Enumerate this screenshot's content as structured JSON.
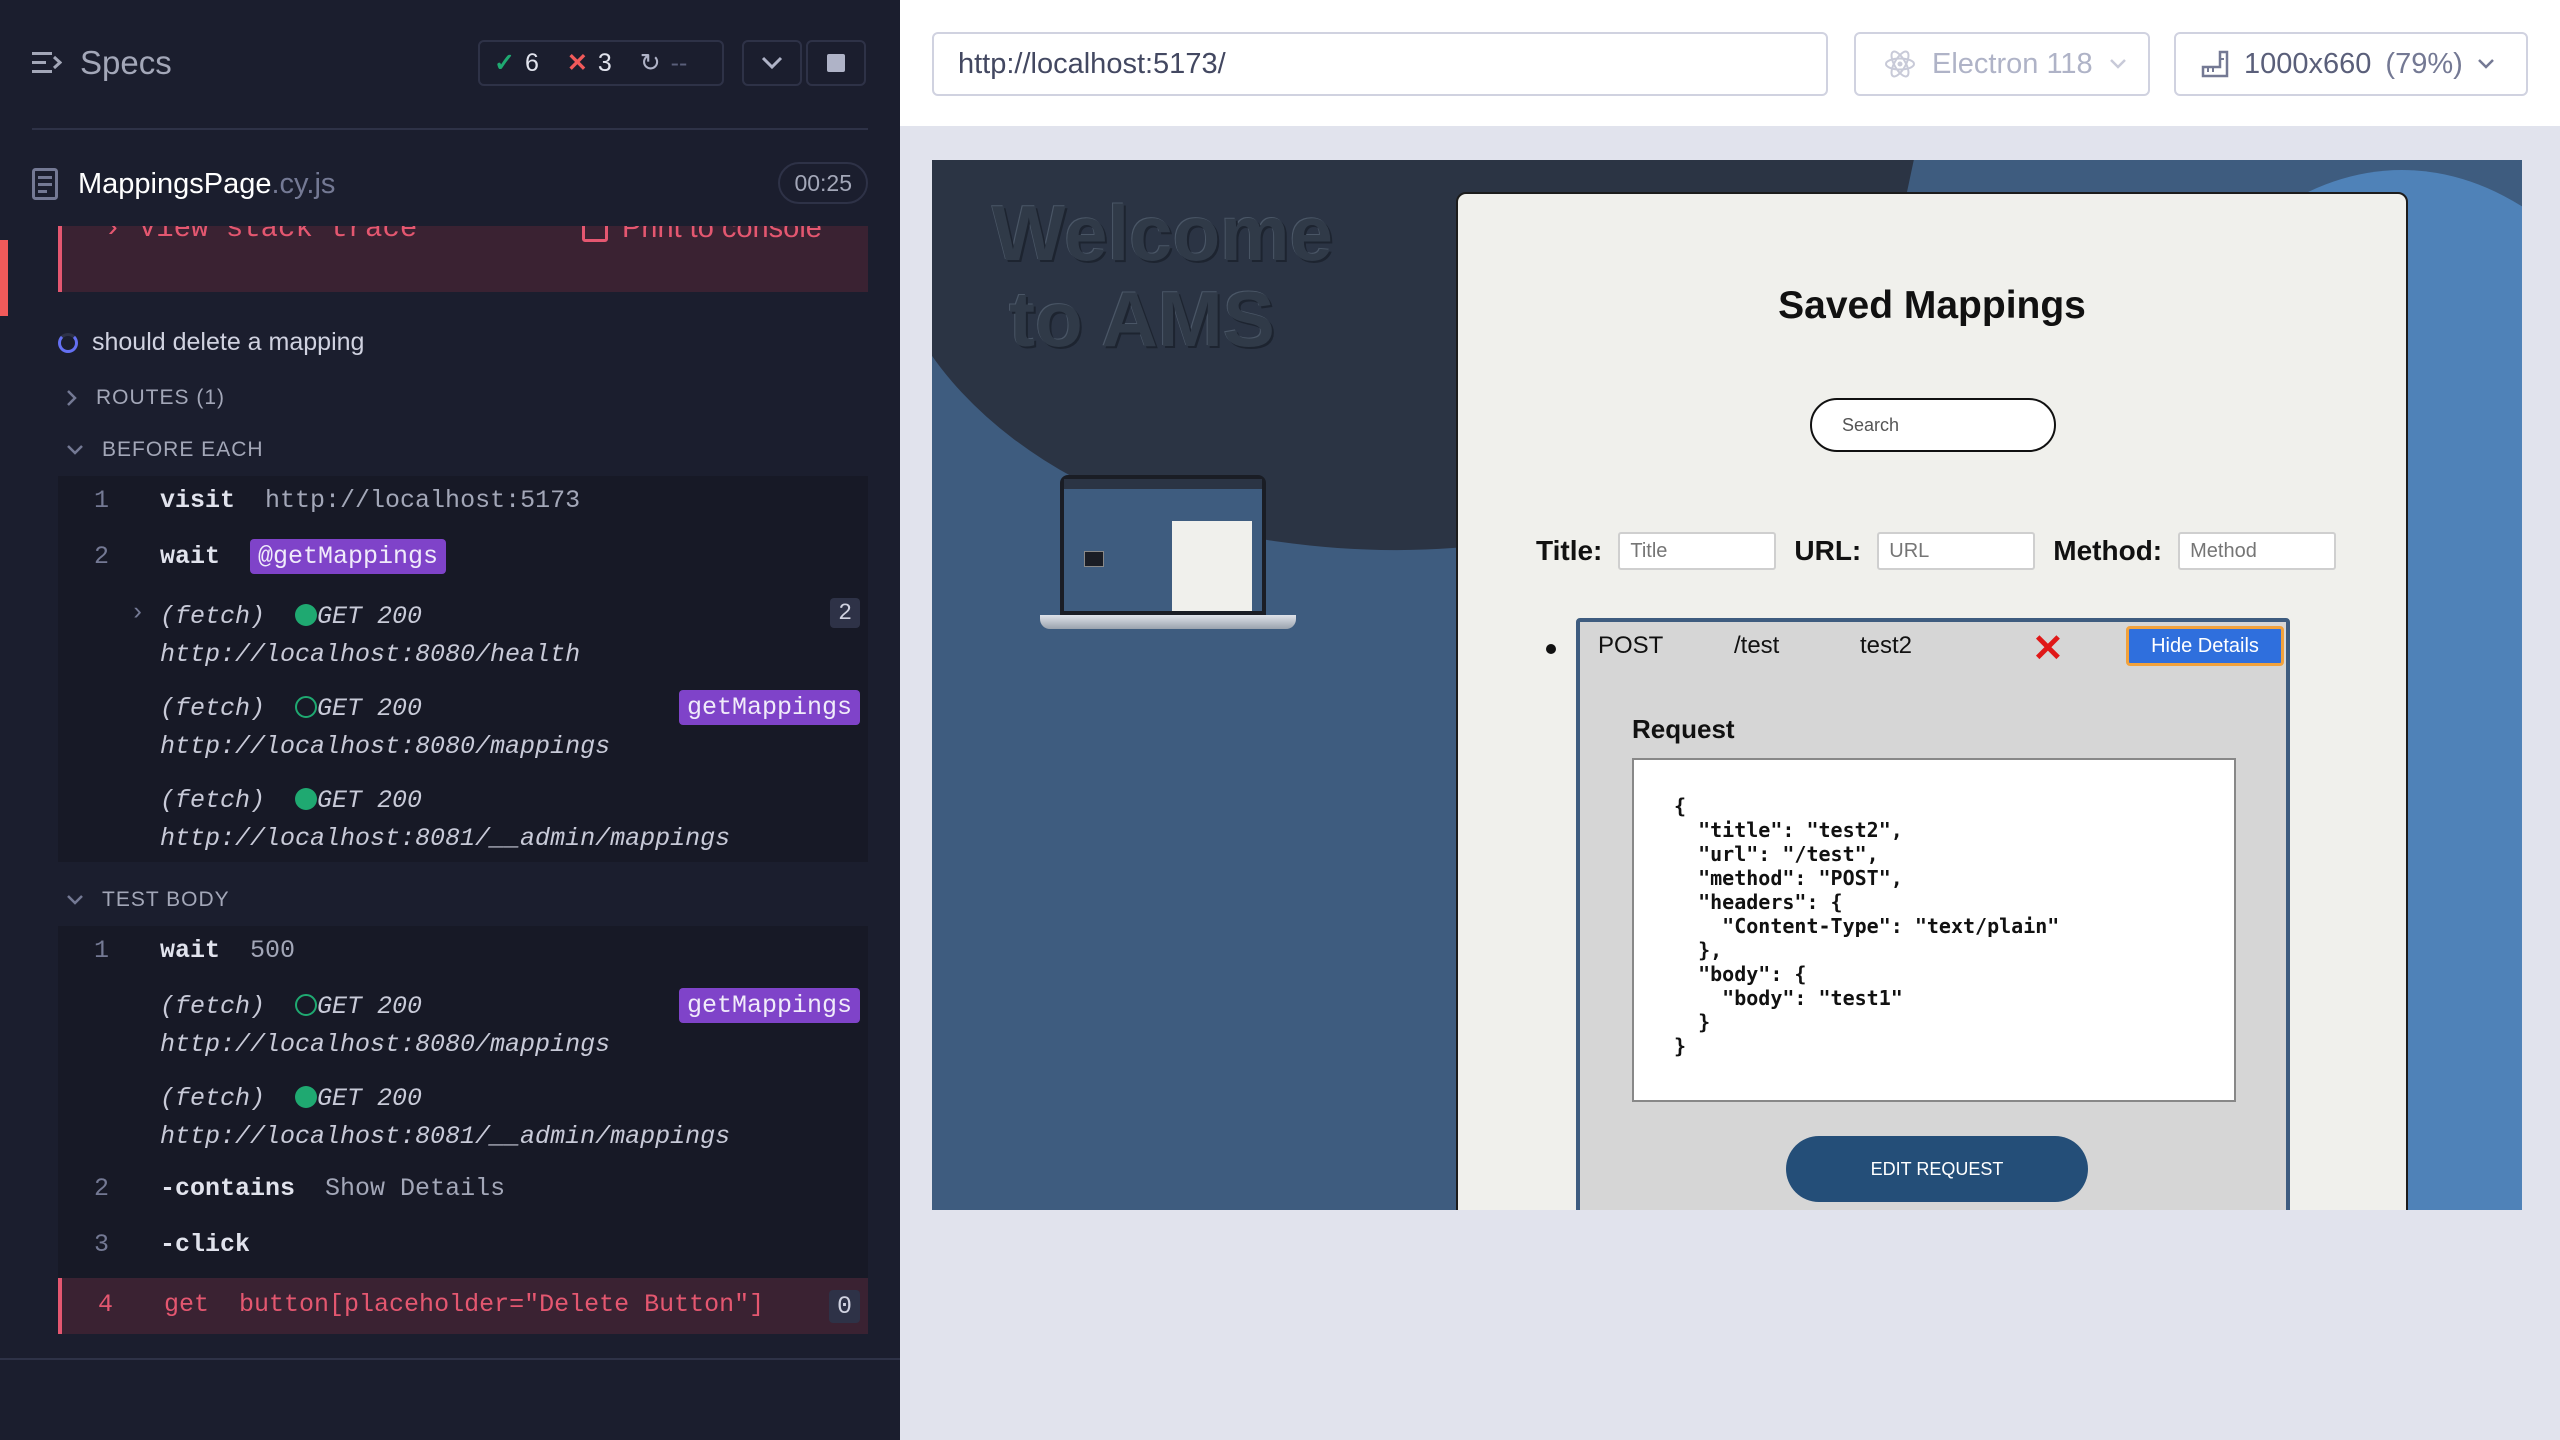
{
  "reporter": {
    "specs_label": "Specs",
    "stats": {
      "passed": "6",
      "failed": "3",
      "pending": "--"
    },
    "spec_file": {
      "name": "MappingsPage",
      "ext": ".cy.js",
      "duration": "00:25"
    },
    "error": {
      "stack_trace_label": "View stack trace",
      "print_label": "Print to console"
    },
    "test_title": "should delete a mapping",
    "routes_label": "ROUTES (1)",
    "before_each_label": "BEFORE EACH",
    "test_body_label": "TEST BODY",
    "before_each": [
      {
        "num": "1",
        "name": "visit",
        "message": "http://localhost:5173"
      },
      {
        "num": "2",
        "name": "wait",
        "alias": "@getMappings"
      }
    ],
    "before_fetches": [
      {
        "type": "(fetch)",
        "status": "GET 200",
        "url": "http://localhost:8080/health",
        "count": "2",
        "filled": true
      },
      {
        "type": "(fetch)",
        "status": "GET 200",
        "url": "http://localhost:8080/mappings",
        "alias": "getMappings",
        "filled": false
      },
      {
        "type": "(fetch)",
        "status": "GET 200",
        "url": "http://localhost:8081/__admin/mappings",
        "filled": true
      }
    ],
    "test_body": [
      {
        "num": "1",
        "name": "wait",
        "message": "500"
      },
      {
        "num": "2",
        "name": "-contains",
        "message": "Show Details"
      },
      {
        "num": "3",
        "name": "-click",
        "message": ""
      },
      {
        "num": "4",
        "name": "get",
        "message": "button[placeholder=\"Delete Button\"]",
        "count": "0"
      }
    ],
    "body_fetches": [
      {
        "type": "(fetch)",
        "status": "GET 200",
        "url": "http://localhost:8080/mappings",
        "alias": "getMappings",
        "filled": false
      },
      {
        "type": "(fetch)",
        "status": "GET 200",
        "url": "http://localhost:8081/__admin/mappings",
        "filled": true
      }
    ]
  },
  "aut_header": {
    "url": "http://localhost:5173/",
    "browser": "Electron 118",
    "viewport": "1000x660",
    "scale": "(79%)"
  },
  "app": {
    "welcome": "Welcome to AMS",
    "card_title": "Saved Mappings",
    "search_placeholder": "Search",
    "form": {
      "title_label": "Title:",
      "title_placeholder": "Title",
      "url_label": "URL:",
      "url_placeholder": "URL",
      "method_label": "Method:",
      "method_placeholder": "Method"
    },
    "mapping": {
      "method": "POST",
      "path": "/test",
      "title": "test2",
      "delete_icon": "✕",
      "hide_details": "Hide Details",
      "request_label": "Request",
      "request_body": "{\n  \"title\": \"test2\",\n  \"url\": \"/test\",\n  \"method\": \"POST\",\n  \"headers\": {\n    \"Content-Type\": \"text/plain\"\n  },\n  \"body\": {\n    \"body\": \"test1\"\n  }\n}",
      "edit_button": "EDIT REQUEST"
    }
  },
  "colors": {
    "reporter_bg": "#1b1e2e",
    "pass": "#1fa971",
    "fail": "#f15a5a",
    "alias": "#7f43c9",
    "app_dark_blue": "#244e78"
  }
}
